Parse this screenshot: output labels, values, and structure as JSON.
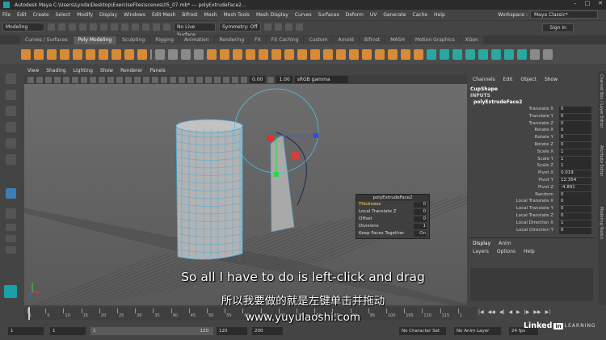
{
  "window": {
    "title": "Autodesk Maya  C:\\Users\\Lynda\\Desktop\\ExerciseFiles\\scenes\\05_07.mb*  ---  polyExtrudeFace2...",
    "controls": [
      "–",
      "□",
      "✕"
    ]
  },
  "menubar": {
    "items": [
      "File",
      "Edit",
      "Create",
      "Select",
      "Modify",
      "Display",
      "Windows",
      "Edit Mesh",
      "Bifrost",
      "Mesh",
      "Mesh Tools",
      "Mesh Display",
      "Curves",
      "Surfaces",
      "Deform",
      "UV",
      "Generate",
      "Cache",
      "Help"
    ],
    "workspace_label": "Workspace :",
    "workspace_value": "Maya Classic*"
  },
  "statusline": {
    "mode": "Modeling",
    "live_surface": "No Live Surface",
    "symmetry": "Symmetry: Off",
    "signin": "Sign In"
  },
  "shelf": {
    "tabs": [
      "Curves / Surfaces",
      "Poly Modeling",
      "Sculpting",
      "Rigging",
      "Animation",
      "Rendering",
      "FX",
      "FX Caching",
      "Custom",
      "Arnold",
      "Bifrost",
      "MASH",
      "Motion Graphics",
      "XGen"
    ],
    "active_tab": "Poly Modeling"
  },
  "panel": {
    "menu": [
      "View",
      "Shading",
      "Lighting",
      "Show",
      "Renderer",
      "Panels"
    ],
    "exposure": "0.00",
    "gamma": "1.00",
    "color_space": "sRGB gamma"
  },
  "attr_editor": {
    "title": "polyExtrudeFace2",
    "rows": [
      {
        "label": "Thickness",
        "value": "0",
        "highlight": true
      },
      {
        "label": "Local Translate Z",
        "value": "0"
      },
      {
        "label": "Offset",
        "value": "0"
      },
      {
        "label": "Divisions",
        "value": "1"
      },
      {
        "label": "Keep Faces Together",
        "value": "On"
      }
    ]
  },
  "channel_box": {
    "menu": [
      "Channels",
      "Edit",
      "Object",
      "Show"
    ],
    "object": "CupShape",
    "inputs_label": "INPUTS",
    "node": "polyExtrudeFace2",
    "channels": [
      {
        "label": "Translate X",
        "value": "0"
      },
      {
        "label": "Translate Y",
        "value": "0"
      },
      {
        "label": "Translate Z",
        "value": "0"
      },
      {
        "label": "Rotate X",
        "value": "0"
      },
      {
        "label": "Rotate Y",
        "value": "0"
      },
      {
        "label": "Rotate Z",
        "value": "0"
      },
      {
        "label": "Scale X",
        "value": "1"
      },
      {
        "label": "Scale Y",
        "value": "1"
      },
      {
        "label": "Scale Z",
        "value": "1"
      },
      {
        "label": "Pivot X",
        "value": "0.019"
      },
      {
        "label": "Pivot Y",
        "value": "12.354"
      },
      {
        "label": "Pivot Z",
        "value": "-4.891"
      },
      {
        "label": "Random",
        "value": "0"
      },
      {
        "label": "Local Translate X",
        "value": "0"
      },
      {
        "label": "Local Translate Y",
        "value": "0"
      },
      {
        "label": "Local Translate Z",
        "value": "0"
      },
      {
        "label": "Local Direction X",
        "value": "1"
      },
      {
        "label": "Local Direction Y",
        "value": "0"
      }
    ],
    "side_tabs": [
      "Channel Box / Layer Editor",
      "Attribute Editor",
      "Modeling Toolkit"
    ]
  },
  "layers": {
    "tabs": [
      "Display",
      "Anim"
    ],
    "active_tab": "Display",
    "menu": [
      "Layers",
      "Options",
      "Help"
    ]
  },
  "timeline": {
    "ticks": [
      "1",
      "5",
      "10",
      "15",
      "20",
      "25",
      "30",
      "35",
      "40",
      "45",
      "50",
      "55",
      "60",
      "65",
      "70",
      "75",
      "80",
      "85",
      "90",
      "95",
      "100",
      "105",
      "110",
      "115",
      "1"
    ],
    "playback_controls": [
      "|◀",
      "◀◀",
      "◀|",
      "◀",
      "▶",
      "|▶",
      "▶▶",
      "▶|"
    ]
  },
  "range": {
    "start": "1",
    "current": "1",
    "range_label": "1",
    "end": "120",
    "anim_end": "120",
    "playback_end": "200",
    "char_set": "No Character Set",
    "anim_layer": "No Anim Layer",
    "fps": "24 fps"
  },
  "subtitles": {
    "english": "So all I have to do is left-click and drag",
    "chinese": "所以我要做的就是左键单击并拖动",
    "watermark": "www.yuyulaoshi.com"
  },
  "branding": {
    "linkedin": "Linked",
    "in": "in",
    "learning": "LEARNING"
  }
}
